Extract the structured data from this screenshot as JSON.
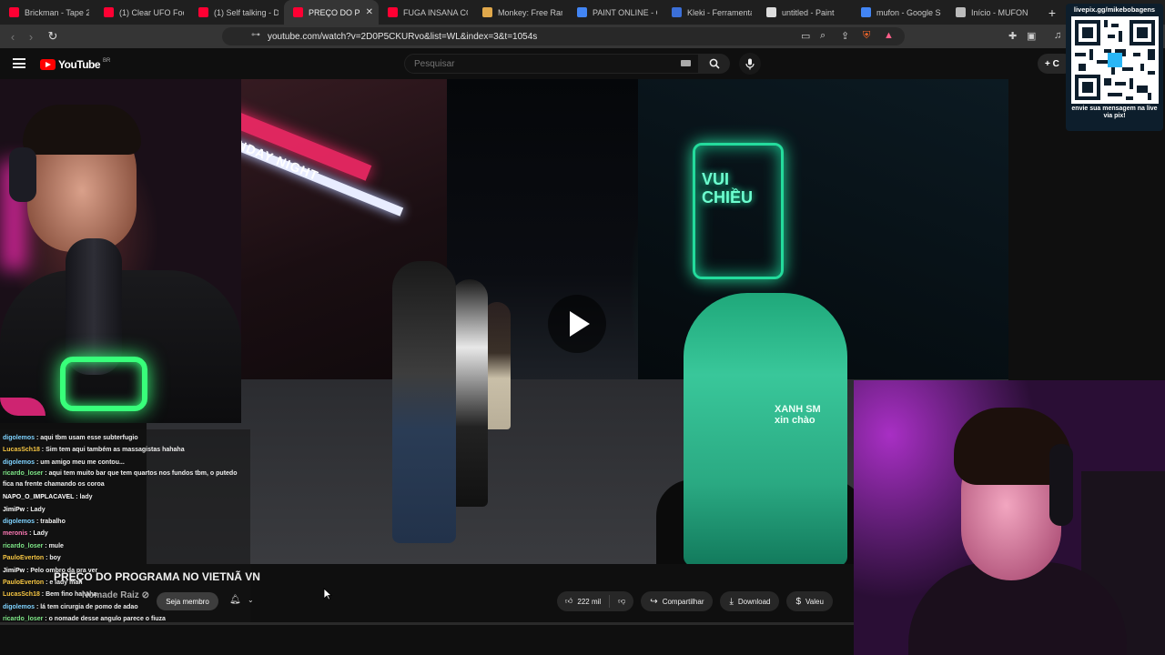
{
  "browser": {
    "tabs": [
      {
        "title": "Brickman - Tape 2 -",
        "favicon_color": "#ff0033"
      },
      {
        "title": "(1) Clear UFO Foota",
        "favicon_color": "#ff0033"
      },
      {
        "title": "(1) Self talking - De",
        "favicon_color": "#ff0033"
      },
      {
        "title": "PREÇO DO P",
        "favicon_color": "#ff0033",
        "active": true
      },
      {
        "title": "FUGA INSANA COM",
        "favicon_color": "#ff0033"
      },
      {
        "title": "Monkey: Free Rand",
        "favicon_color": "#e0a84b"
      },
      {
        "title": "PAINT ONLINE - Go",
        "favicon_color": "#4285f4"
      },
      {
        "title": "Kleki - Ferramenta",
        "favicon_color": "#3b6fd8"
      },
      {
        "title": "untitled - Paint",
        "favicon_color": "#dddddd"
      },
      {
        "title": "mufon - Google Se",
        "favicon_color": "#4285f4"
      },
      {
        "title": "Início - MUFON",
        "favicon_color": "#bbbbbb"
      }
    ],
    "active_tab_close": "✕",
    "new_tab": "+",
    "url": "youtube.com/watch?v=2D0P5CKURvo&list=WL&index=3&t=1054s"
  },
  "youtube": {
    "logo_text": "YouTube",
    "country_code": "BR",
    "search_placeholder": "Pesquisar",
    "create_label": "+ C"
  },
  "video": {
    "sign_sunday": "SUNDAY NIGHT",
    "sign_vui": "VUI CHIỀU",
    "rider_jacket": "XANH SM\nxin chào"
  },
  "chat": [
    {
      "user": "digolemos",
      "color": "#7fd3ff",
      "msg": " : aqui tbm usam esse subterfugio"
    },
    {
      "user": "LucasSch18",
      "color": "#f5c542",
      "msg": " : Sim tem aqui também as massagistas hahaha"
    },
    {
      "user": "digolemos",
      "color": "#7fd3ff",
      "msg": " : um amigo meu me contou..."
    },
    {
      "user": "ricardo_loser",
      "color": "#7ee787",
      "msg": " : aqui tem muito bar que tem quartos nos fundos tbm, o putedo fica na frente chamando os coroa",
      "wrap": true
    },
    {
      "user": "NAPO_O_IMPLACAVEL",
      "color": "#ffffff",
      "msg": " : lady"
    },
    {
      "user": "JimiPw",
      "color": "#ffffff",
      "msg": " : Lady"
    },
    {
      "user": "digolemos",
      "color": "#7fd3ff",
      "msg": " : trabalho"
    },
    {
      "user": "meronis",
      "color": "#ff7ab6",
      "msg": " : Lady"
    },
    {
      "user": "ricardo_loser",
      "color": "#7ee787",
      "msg": " : mule"
    },
    {
      "user": "PauloEverton",
      "color": "#f5c542",
      "msg": " : boy"
    },
    {
      "user": "JimiPw",
      "color": "#ffffff",
      "msg": " : Pelo ombro da pra ver"
    },
    {
      "user": "PauloEverton",
      "color": "#f5c542",
      "msg": " : e lady man"
    },
    {
      "user": "LucasSch18",
      "color": "#f5c542",
      "msg": " : Bem fino hahaha"
    },
    {
      "user": "digolemos",
      "color": "#7fd3ff",
      "msg": " : lá tem cirurgia de pomo de adao"
    },
    {
      "user": "ricardo_loser",
      "color": "#7ee787",
      "msg": " : o nomade desse angulo parece o fiuza"
    }
  ],
  "info": {
    "title": "PREÇO DO PROGRAMA NO VIETNÃ VN",
    "channel": "Nomade Raiz ⊘",
    "member_label": "Seja membro",
    "likes": "222 mil",
    "share": "Compartilhar",
    "download": "Download",
    "thanks": "Valeu"
  },
  "overlay": {
    "qr_url": "livepix.gg/mikebobagens",
    "qr_note": "envie sua mensagem na live via pix!"
  }
}
